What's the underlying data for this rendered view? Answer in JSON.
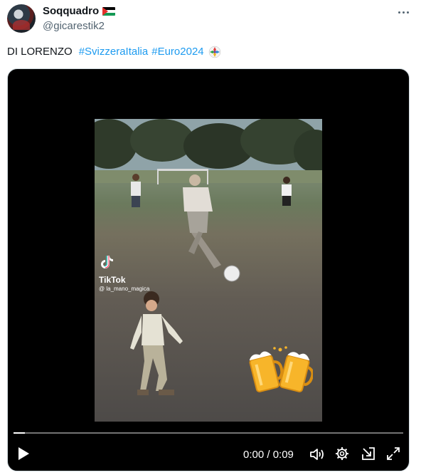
{
  "author": {
    "display_name": "Soqquadro",
    "handle": "@gicarestik2",
    "flag_icon": "palestine-flag-icon"
  },
  "tweet": {
    "text": "DI LORENZO",
    "hashtags": [
      "#SvizzeraItalia",
      "#Euro2024"
    ],
    "hashtag_color": "#1d9bf0",
    "emoji_icon": "euro2024-trophy-emoji-icon"
  },
  "video": {
    "watermark_brand": "TikTok",
    "watermark_user": "@ la_mano_magica",
    "overlay_icon": "cheers-beer-mugs-icon",
    "current_time": "0:00",
    "duration": "0:09",
    "time_display": "0:00 / 0:09",
    "progress": 0.03
  },
  "controls": {
    "play_icon": "play-icon",
    "volume_icon": "volume-icon",
    "settings_icon": "gear-icon",
    "popout_icon": "popout-icon",
    "fullscreen_icon": "fullscreen-icon"
  }
}
